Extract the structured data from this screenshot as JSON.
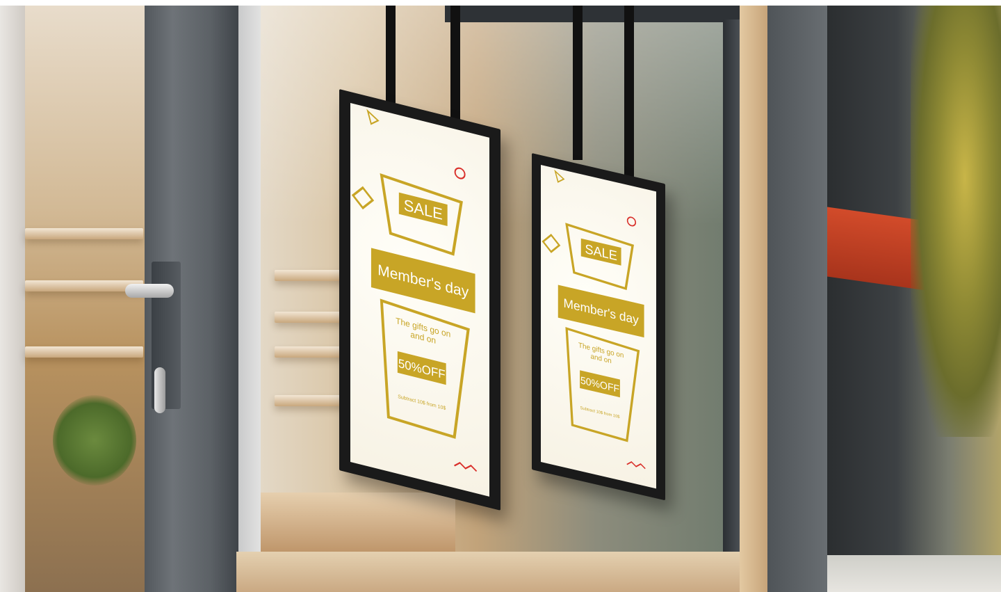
{
  "scene": {
    "description_visible_text": "two hanging digital signage displays in a shop window"
  },
  "signs": [
    {
      "badge": "SALE",
      "headline": "Member's day",
      "subline_1": "The gifts go on",
      "subline_2": "and on",
      "offer": "50%OFF",
      "fine_print": "Subtract 10$ from 10$",
      "accent_color": "#c8a526",
      "highlight_color": "#d9302b"
    },
    {
      "badge": "SALE",
      "headline": "Member's day",
      "subline_1": "The gifts go on",
      "subline_2": "and on",
      "offer": "50%OFF",
      "fine_print": "Subtract 10$ from 10$",
      "accent_color": "#c8a526",
      "highlight_color": "#d9302b"
    }
  ]
}
